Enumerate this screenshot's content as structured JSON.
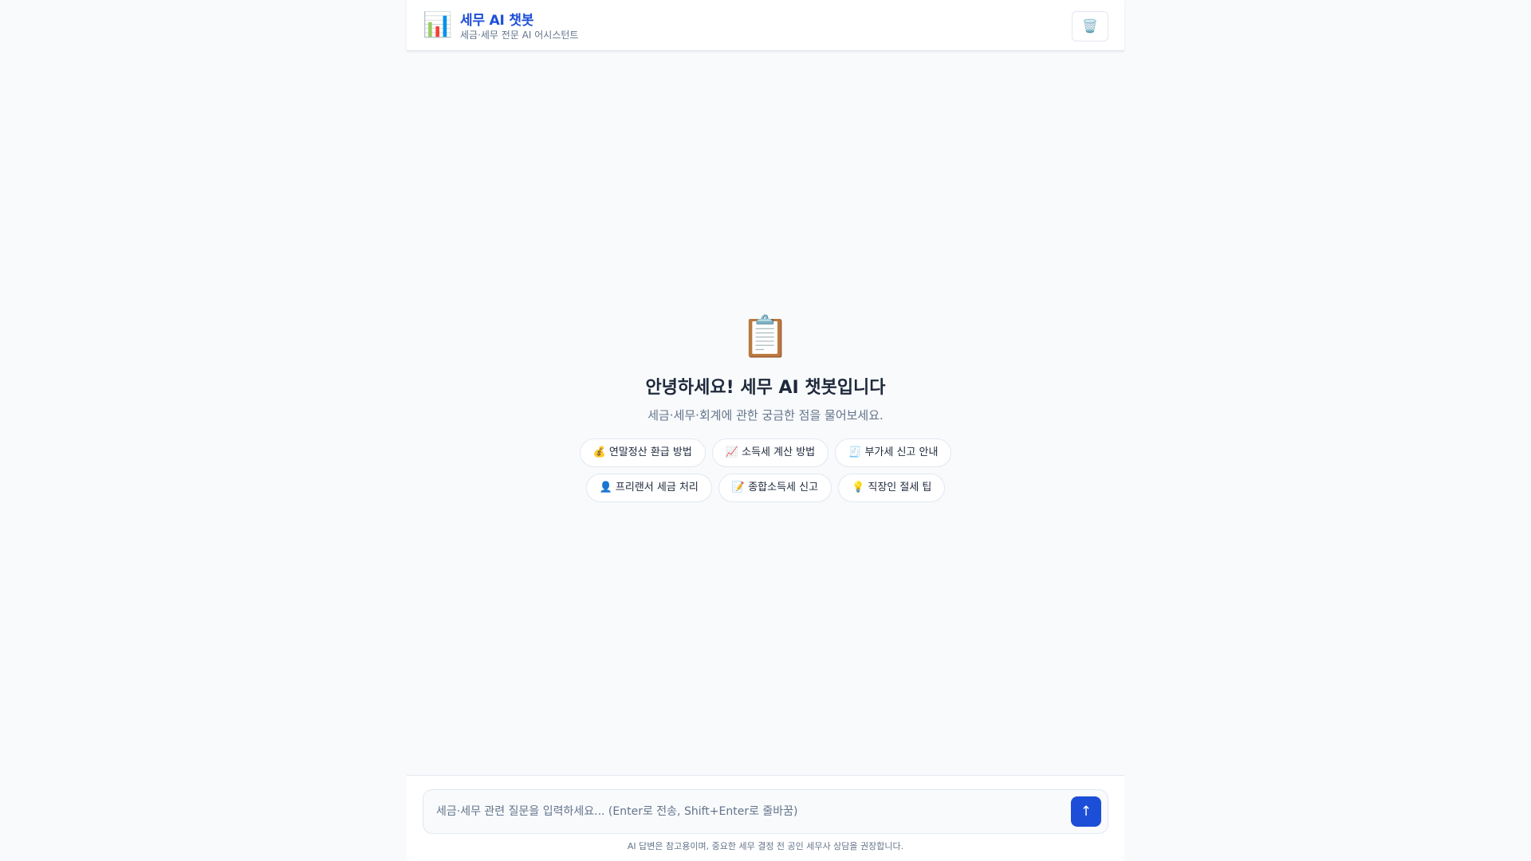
{
  "header": {
    "logo_icon": "📊",
    "logo_icon_name": "bar-chart-icon",
    "title": "세무 AI 챗봇",
    "subtitle": "세금·세무 전문 AI 어시스턴트",
    "clear_icon": "🗑️",
    "clear_icon_name": "trash-icon"
  },
  "welcome": {
    "icon": "📋",
    "icon_name": "clipboard-icon",
    "title": "안녕하세요! 세무 AI 챗봇입니다",
    "description": "세금·세무·회계에 관한 궁금한 점을 물어보세요.",
    "suggestions": [
      "💰 연말정산 환급 방법",
      "📈 소득세 계산 방법",
      "🧾 부가세 신고 안내",
      "👤 프리랜서 세금 처리",
      "📝 종합소득세 신고",
      "💡 직장인 절세 팁"
    ]
  },
  "input": {
    "placeholder": "세금·세무 관련 질문을 입력하세요... (Enter로 전송, Shift+Enter로 줄바꿈)",
    "value": "",
    "send_icon": "↑",
    "send_icon_name": "arrow-up-icon"
  },
  "footer": {
    "disclaimer": "AI 답변은 참고용이며, 중요한 세무 결정 전 공인 세무사 상담을 권장합니다."
  },
  "colors": {
    "accent": "#1d4ed8",
    "background": "#f8fafc",
    "border": "#e2e8f0",
    "muted_text": "#64748b"
  }
}
